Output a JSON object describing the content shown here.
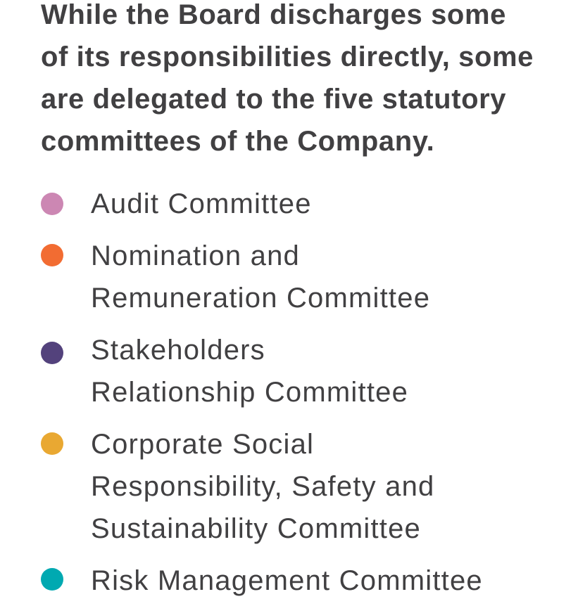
{
  "intro": {
    "lines": [
      "While the Board discharges some",
      "of its responsibilities directly, some",
      "are delegated to the five statutory",
      "committees of the Company."
    ]
  },
  "committees": [
    {
      "lines": [
        "Audit Committee"
      ],
      "color": "#cc87b3",
      "icon": "pink-bullet-dot"
    },
    {
      "lines": [
        "Nomination and",
        "Remuneration Committee"
      ],
      "color": "#f26c32",
      "icon": "orange-bullet-dot"
    },
    {
      "lines": [
        "Stakeholders",
        "Relationship Committee"
      ],
      "color": "#53427c",
      "icon": "purple-bullet-dot"
    },
    {
      "lines": [
        "Corporate Social",
        "Responsibility, Safety and",
        "Sustainability Committee"
      ],
      "color": "#e9a832",
      "icon": "yellow-bullet-dot"
    },
    {
      "lines": [
        "Risk Management Committee"
      ],
      "color": "#00a9b1",
      "icon": "teal-bullet-dot"
    }
  ]
}
